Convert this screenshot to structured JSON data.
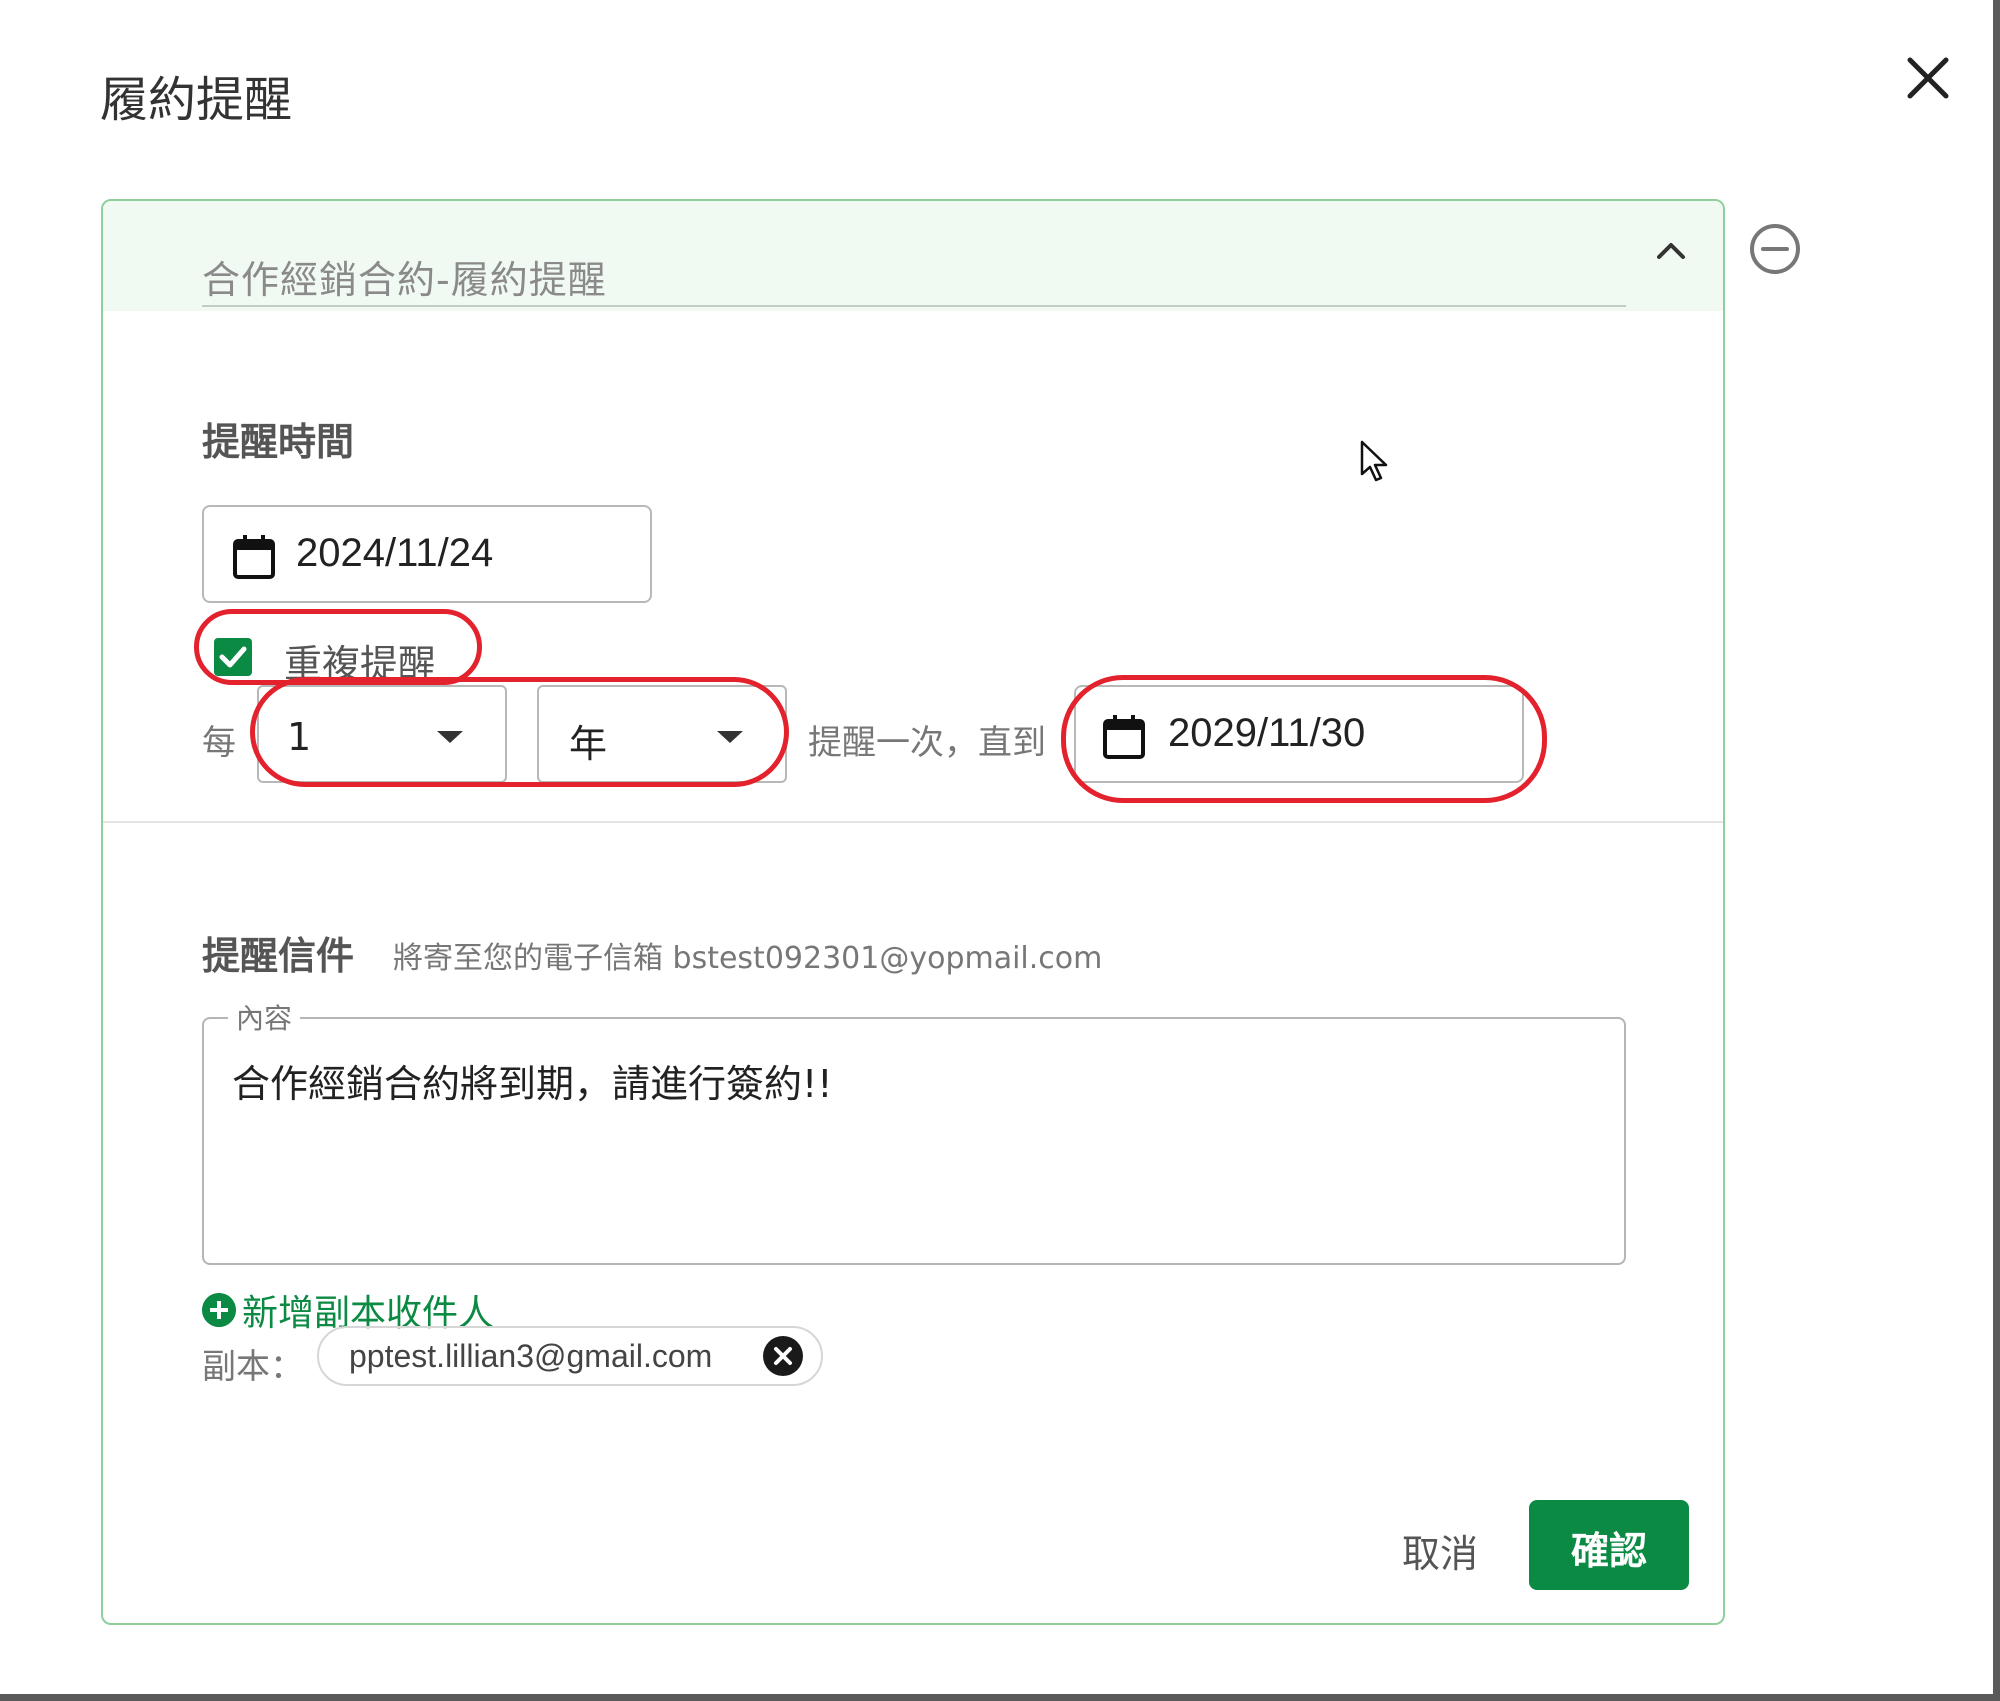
{
  "dialog": {
    "title": "履約提醒",
    "close_icon": "close-icon"
  },
  "reminder": {
    "title_value": "合作經銷合約-履約提醒",
    "collapse_icon": "chevron-up-icon",
    "remove_icon": "minus-circle-icon",
    "time_section": {
      "heading": "提醒時間",
      "start_date": "2024/11/24",
      "repeat_checked": true,
      "repeat_label": "重複提醒",
      "every_label": "每",
      "interval_value": "1",
      "unit_value": "年",
      "until_label": "提醒一次，直到",
      "end_date": "2029/11/30"
    },
    "mail_section": {
      "heading": "提醒信件",
      "note": "將寄至您的電子信箱 bstest092301@yopmail.com",
      "content_label": "內容",
      "content_value": "合作經銷合約將到期，請進行簽約!!",
      "add_cc_label": "新增副本收件人",
      "cc_label": "副本：",
      "cc_recipients": [
        "pptest.lillian3@gmail.com"
      ]
    },
    "actions": {
      "cancel_label": "取消",
      "confirm_label": "確認"
    }
  },
  "colors": {
    "accent": "#0b8a43",
    "highlight_ring": "#e3222d",
    "card_border": "#8fcf9d"
  }
}
